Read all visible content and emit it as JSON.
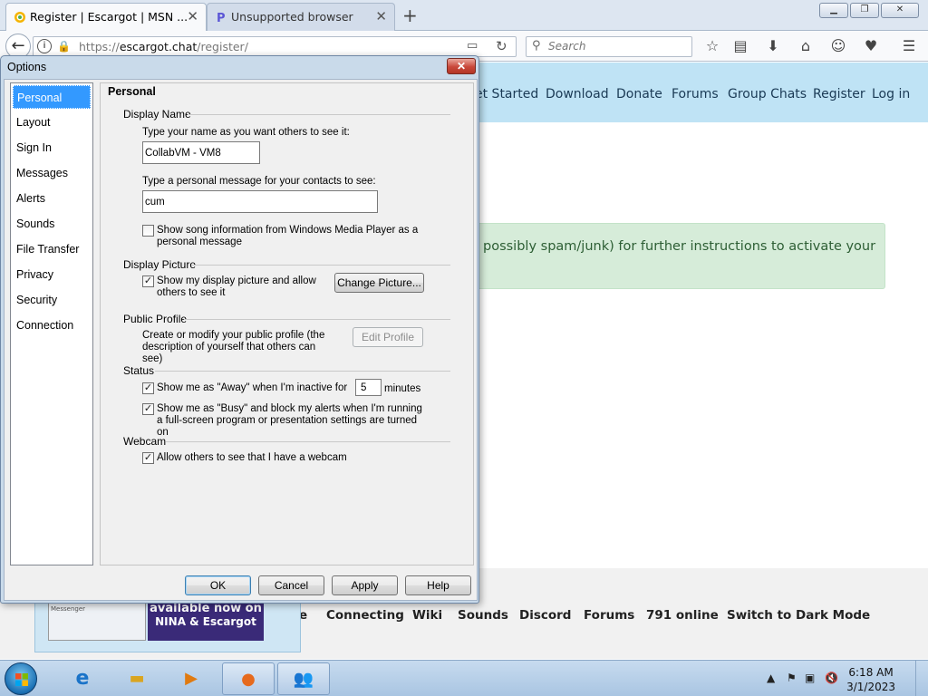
{
  "browser": {
    "tabs": [
      {
        "title": "Register | Escargot | MSN ..."
      },
      {
        "title": "Unsupported browser"
      }
    ],
    "url_prefix": "https://",
    "url_host": "escargot.chat",
    "url_path": "/register/",
    "search_placeholder": "Search"
  },
  "site": {
    "nav": [
      "et Started",
      "Download",
      "Donate",
      "Forums",
      "Group Chats",
      "Register",
      "Log in"
    ],
    "alert_text": "possibly spam/junk) for further instructions to activate your",
    "footer_links": [
      "e",
      "Connecting",
      "Wiki",
      "Sounds",
      "Discord",
      "Forums",
      "791 online",
      "Switch to Dark Mode"
    ],
    "promo": {
      "line1": "available now on",
      "line2": "NINA & Escargot",
      "shot_text": "Messenger"
    }
  },
  "dialog": {
    "title": "Options",
    "close_label": "✕",
    "categories": [
      "Personal",
      "Layout",
      "Sign In",
      "Messages",
      "Alerts",
      "Sounds",
      "File Transfer",
      "Privacy",
      "Security",
      "Connection"
    ],
    "panel_title": "Personal",
    "display_name": {
      "group": "Display Name",
      "name_label": "Type your name as you want others to see it:",
      "name_value": "CollabVM - VM8",
      "msg_label": "Type a personal message for your contacts to see:",
      "msg_value": "cum",
      "song_label": "Show song information from Windows Media Player as a personal message",
      "song_checked": false
    },
    "display_picture": {
      "group": "Display Picture",
      "show_label": "Show my display picture and allow others to see it",
      "show_checked": true,
      "change_button": "Change Picture..."
    },
    "public_profile": {
      "group": "Public Profile",
      "desc": "Create or modify your public profile (the description of yourself that others can see)",
      "edit_button": "Edit Profile"
    },
    "status": {
      "group": "Status",
      "away_label": "Show me as \"Away\" when I'm inactive for",
      "away_checked": true,
      "away_minutes": "5",
      "minutes_label": "minutes",
      "busy_label": "Show me as \"Busy\" and block my alerts when I'm running a full-screen program or presentation settings are turned on",
      "busy_checked": true
    },
    "webcam": {
      "group": "Webcam",
      "allow_label": "Allow others to see that I have a webcam",
      "allow_checked": true
    },
    "buttons": {
      "ok": "OK",
      "cancel": "Cancel",
      "apply": "Apply",
      "help": "Help"
    }
  },
  "taskbar": {
    "time": "6:18 AM",
    "date": "3/1/2023"
  },
  "colors": {
    "selection": "#3399ff",
    "site_header": "#bfe3f5",
    "alert_bg": "#d6ecd9"
  }
}
